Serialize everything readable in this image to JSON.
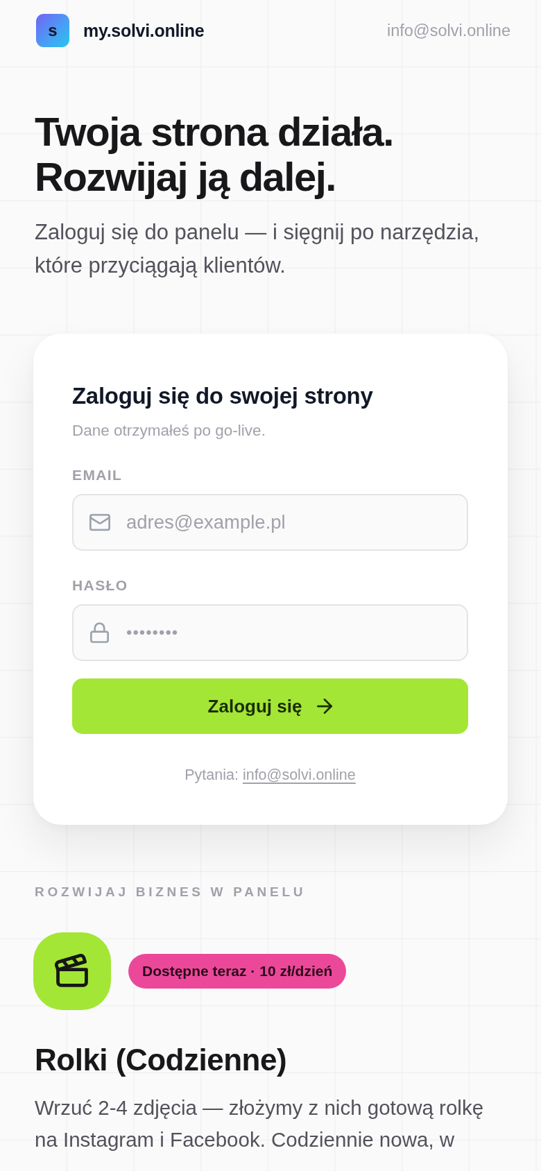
{
  "header": {
    "logo_letter": "s",
    "site_name": "my.solvi.online",
    "contact_email": "info@solvi.online"
  },
  "hero": {
    "title": "Twoja strona działa. Rozwijaj ją dalej.",
    "subtitle": "Zaloguj się do panelu — i sięgnij po narzędzia, które przyciągają klientów."
  },
  "login_card": {
    "title": "Zaloguj się do swojej strony",
    "subtitle": "Dane otrzymałeś po go-live.",
    "fields": [
      {
        "kind": "email",
        "label": "EMAIL",
        "placeholder": "adres@example.pl"
      },
      {
        "kind": "password",
        "label": "HASŁO",
        "placeholder": "••••••••"
      }
    ],
    "submit_button": "Zaloguj się",
    "help_text": "Pytania:",
    "help_link": "info@solvi.online"
  },
  "features": {
    "heading": "ROZWIJAJ BIZNES W PANELU",
    "items": [
      {
        "badge": "Dostępne teraz · 10 zł/dzień",
        "title": "Rolki (Codzienne)",
        "description": "Wrzuć 2-4 zdjęcia — złożymy z nich gotową rolkę na Instagram i Facebook. Codziennie nowa, w"
      }
    ]
  }
}
